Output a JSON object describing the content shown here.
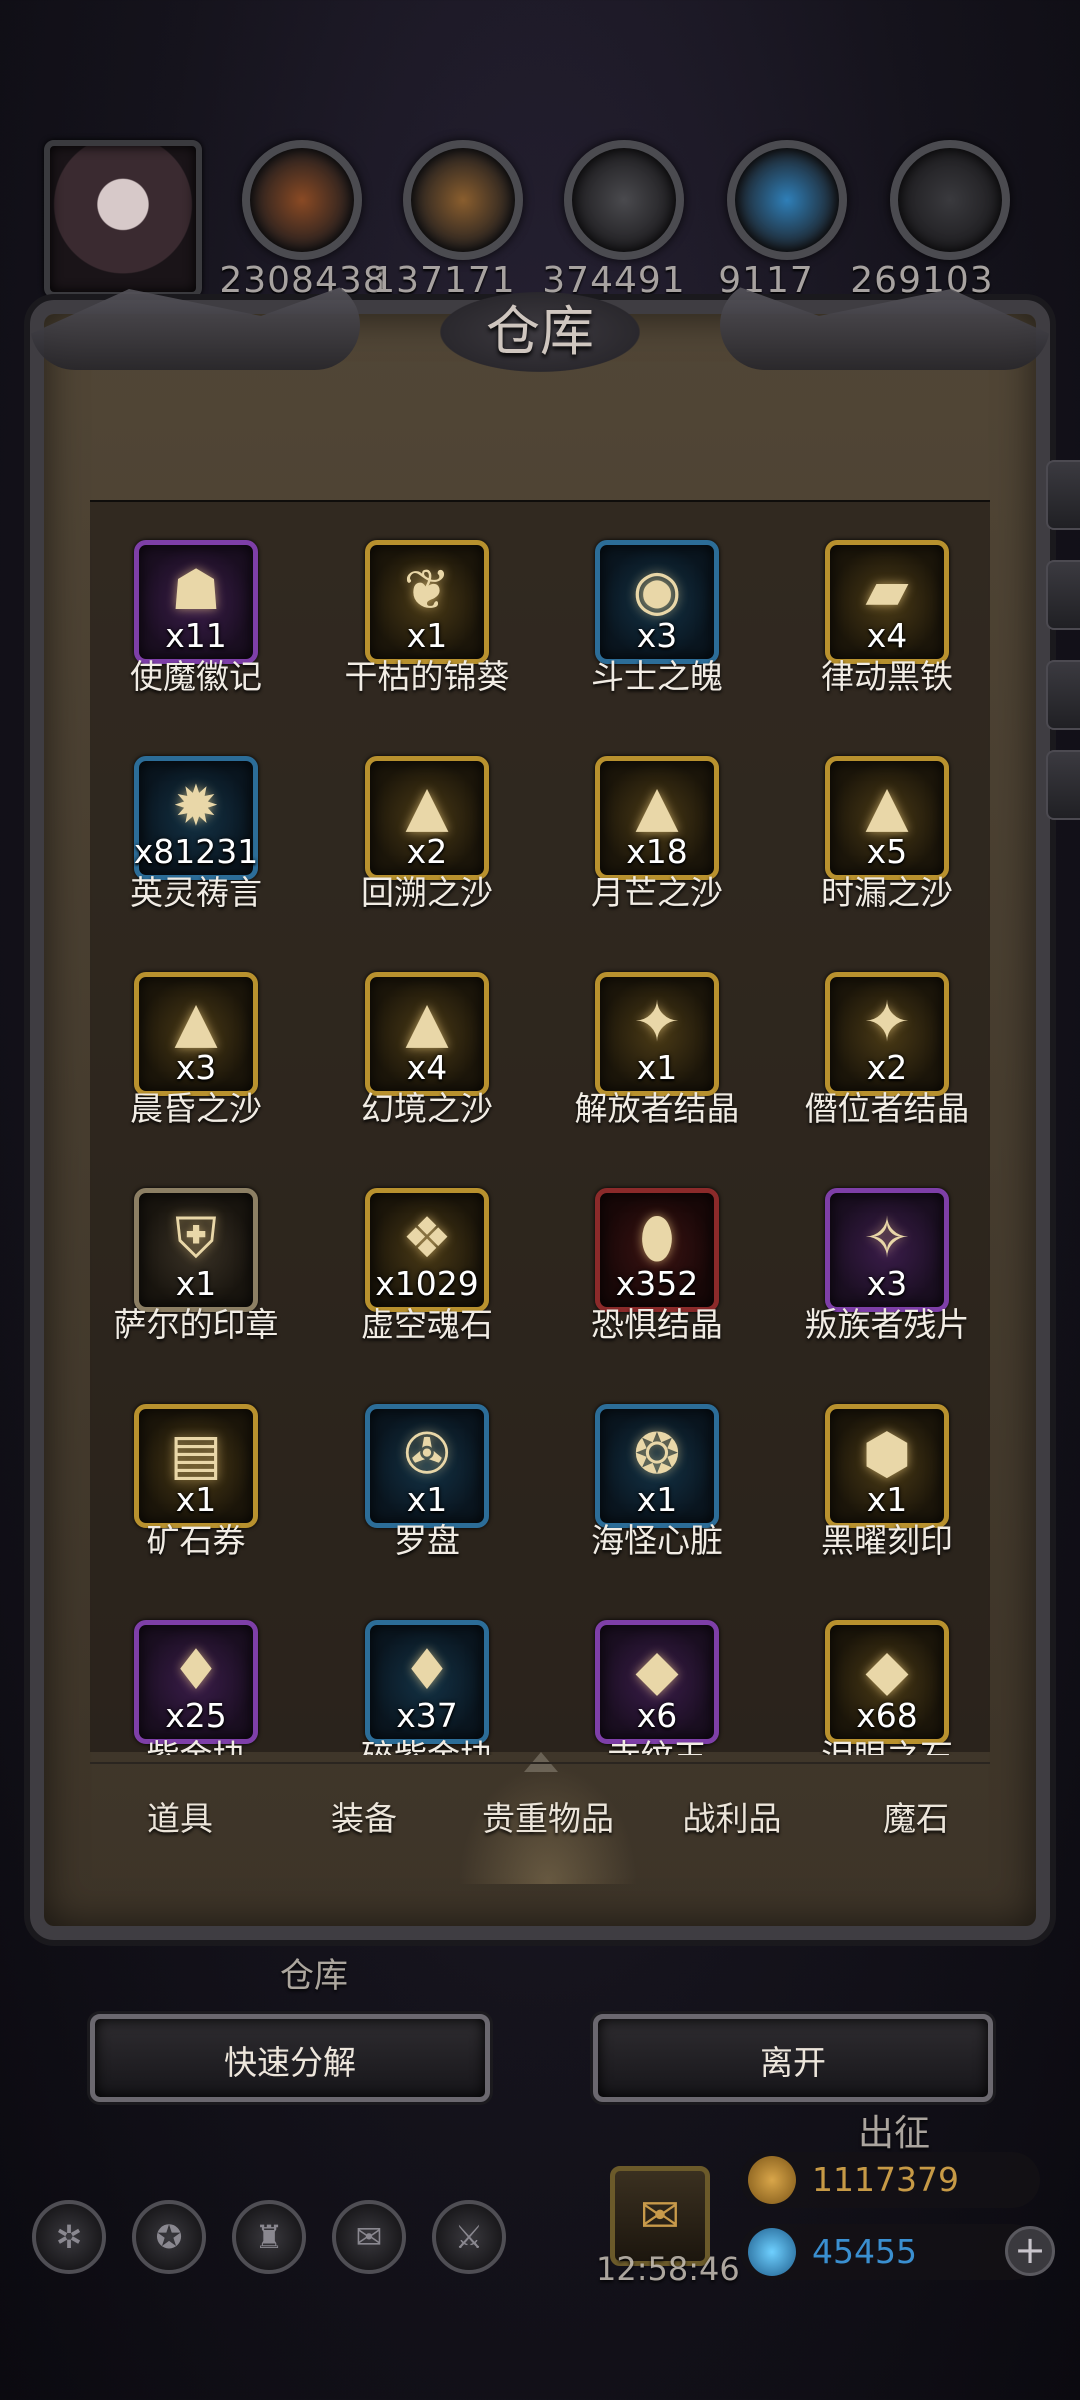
{
  "resources": [
    {
      "name": "ore-icon-1",
      "value": "2308438",
      "color": "#8a4a24"
    },
    {
      "name": "wood-icon",
      "value": "137171",
      "color": "#8a5e2e"
    },
    {
      "name": "metal-ingot-icon",
      "value": "374491",
      "color": "#4a4a4e"
    },
    {
      "name": "crystal-icon",
      "value": "9117",
      "color": "#2f7fb8"
    },
    {
      "name": "dark-ingot-icon",
      "value": "269103",
      "color": "#3a3a3e"
    }
  ],
  "panel": {
    "title": "仓库"
  },
  "items": [
    {
      "name": "使魔徽记",
      "qty": "x11",
      "frame": "purple",
      "icon": "☗"
    },
    {
      "name": "干枯的锦葵",
      "qty": "x1",
      "frame": "gold",
      "icon": "❦"
    },
    {
      "name": "斗士之魄",
      "qty": "x3",
      "frame": "blue",
      "icon": "◉"
    },
    {
      "name": "律动黑铁",
      "qty": "x4",
      "frame": "gold",
      "icon": "▰"
    },
    {
      "name": "英灵祷言",
      "qty": "x81231",
      "frame": "blue",
      "icon": "✹"
    },
    {
      "name": "回溯之沙",
      "qty": "x2",
      "frame": "gold",
      "icon": "▲"
    },
    {
      "name": "月芒之沙",
      "qty": "x18",
      "frame": "gold",
      "icon": "▲"
    },
    {
      "name": "时漏之沙",
      "qty": "x5",
      "frame": "gold",
      "icon": "▲"
    },
    {
      "name": "晨昏之沙",
      "qty": "x3",
      "frame": "gold",
      "icon": "▲"
    },
    {
      "name": "幻境之沙",
      "qty": "x4",
      "frame": "gold",
      "icon": "▲"
    },
    {
      "name": "解放者结晶",
      "qty": "x1",
      "frame": "gold",
      "icon": "✦"
    },
    {
      "name": "僭位者结晶",
      "qty": "x2",
      "frame": "gold",
      "icon": "✦"
    },
    {
      "name": "萨尔的印章",
      "qty": "x1",
      "frame": "tan",
      "icon": "⛨"
    },
    {
      "name": "虚空魂石",
      "qty": "x1029",
      "frame": "gold",
      "icon": "❖"
    },
    {
      "name": "恐惧结晶",
      "qty": "x352",
      "frame": "red",
      "icon": "⬮"
    },
    {
      "name": "叛族者残片",
      "qty": "x3",
      "frame": "purple",
      "icon": "✧"
    },
    {
      "name": "矿石券",
      "qty": "x1",
      "frame": "gold",
      "icon": "▤"
    },
    {
      "name": "罗盘",
      "qty": "x1",
      "frame": "blue",
      "icon": "✇"
    },
    {
      "name": "海怪心脏",
      "qty": "x1",
      "frame": "blue",
      "icon": "❂"
    },
    {
      "name": "黑曜刻印",
      "qty": "x1",
      "frame": "gold",
      "icon": "⬢"
    },
    {
      "name": "紫金块",
      "qty": "x25",
      "frame": "purple",
      "icon": "♦"
    },
    {
      "name": "碎紫金块",
      "qty": "x37",
      "frame": "blue",
      "icon": "♦"
    },
    {
      "name": "寺纹玉",
      "qty": "x6",
      "frame": "purple",
      "icon": "◆"
    },
    {
      "name": "泪眼之石",
      "qty": "x68",
      "frame": "gold",
      "icon": "◆"
    }
  ],
  "tabs": [
    "道具",
    "装备",
    "贵重物品",
    "战利品",
    "魔石"
  ],
  "active_tab": 2,
  "buttons": {
    "quick_dismantle": "快速分解",
    "leave": "离开"
  },
  "background_hud": {
    "warehouse_label": "仓库",
    "expedition_label": "出征",
    "timer": "12:58:46",
    "gold": "1117379",
    "gems": "45455"
  }
}
